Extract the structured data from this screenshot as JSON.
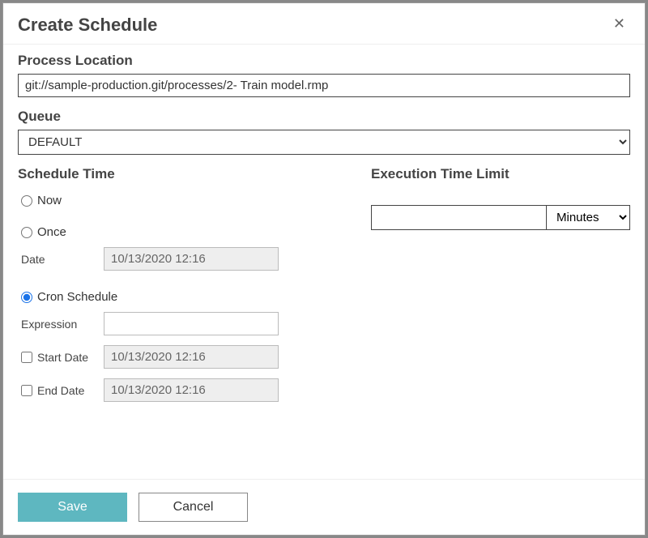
{
  "modal": {
    "title": "Create Schedule",
    "close": "✕"
  },
  "process_location": {
    "label": "Process Location",
    "value": "git://sample-production.git/processes/2- Train model.rmp"
  },
  "queue": {
    "label": "Queue",
    "value": "DEFAULT"
  },
  "schedule_time": {
    "label": "Schedule Time",
    "now": {
      "label": "Now"
    },
    "once": {
      "label": "Once",
      "date_label": "Date",
      "date_value": "10/13/2020 12:16"
    },
    "cron": {
      "label": "Cron Schedule",
      "expression_label": "Expression",
      "expression_value": "",
      "start_date_label": "Start Date",
      "start_date_value": "10/13/2020 12:16",
      "end_date_label": "End Date",
      "end_date_value": "10/13/2020 12:16"
    }
  },
  "exec_limit": {
    "label": "Execution Time Limit",
    "value": "",
    "unit": "Minutes"
  },
  "footer": {
    "save": "Save",
    "cancel": "Cancel"
  }
}
